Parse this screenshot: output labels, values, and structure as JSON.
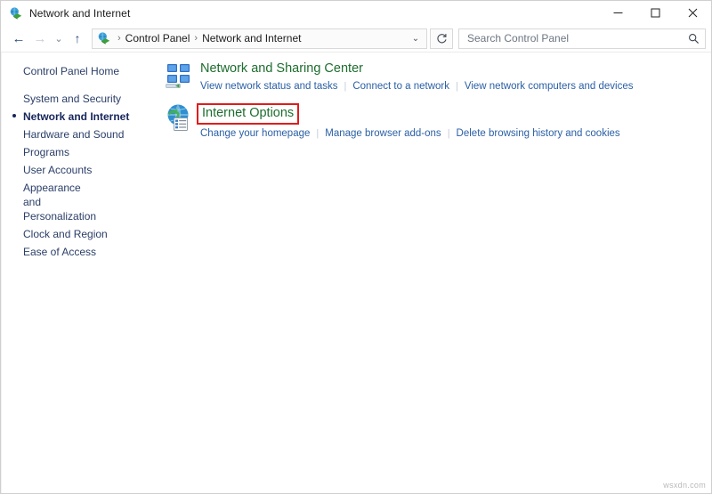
{
  "window": {
    "title": "Network and Internet",
    "title_icon": "network-globe-icon",
    "controls": {
      "minimize": "─",
      "maximize": "□",
      "close": "✕"
    }
  },
  "navbar": {
    "back": "←",
    "forward": "→",
    "recent": "⌄",
    "up": "↑",
    "refresh": "↻",
    "dropdown": "⌄",
    "breadcrumb": {
      "icon": "network-globe-icon",
      "separator": "›",
      "items": [
        {
          "label": "Control Panel"
        },
        {
          "label": "Network and Internet"
        }
      ]
    },
    "search": {
      "placeholder": "Search Control Panel",
      "value": "",
      "icon": "search-icon"
    }
  },
  "sidebar": {
    "home_label": "Control Panel Home",
    "items": [
      {
        "label": "System and Security",
        "current": false
      },
      {
        "label": "Network and Internet",
        "current": true
      },
      {
        "label": "Hardware and Sound",
        "current": false
      },
      {
        "label": "Programs",
        "current": false
      },
      {
        "label": "User Accounts",
        "current": false
      },
      {
        "label": "Appearance and Personalization",
        "current": false
      },
      {
        "label": "Clock and Region",
        "current": false
      },
      {
        "label": "Ease of Access",
        "current": false
      }
    ]
  },
  "content": {
    "categories": [
      {
        "icon": "network-sharing-center-icon",
        "title": "Network and Sharing Center",
        "highlighted": false,
        "links": [
          "View network status and tasks",
          "Connect to a network",
          "View network computers and devices"
        ]
      },
      {
        "icon": "internet-options-icon",
        "title": "Internet Options",
        "highlighted": true,
        "links": [
          "Change your homepage",
          "Manage browser add-ons",
          "Delete browsing history and cookies"
        ]
      }
    ]
  },
  "colors": {
    "category_title": "#1d6d2e",
    "link": "#2a5fa5",
    "sidebar_text": "#2a3e68",
    "sidebar_current": "#16255a",
    "highlight_box": "#e01b1b",
    "close_hover": "#e81123"
  },
  "watermark": "wsxdn.com"
}
